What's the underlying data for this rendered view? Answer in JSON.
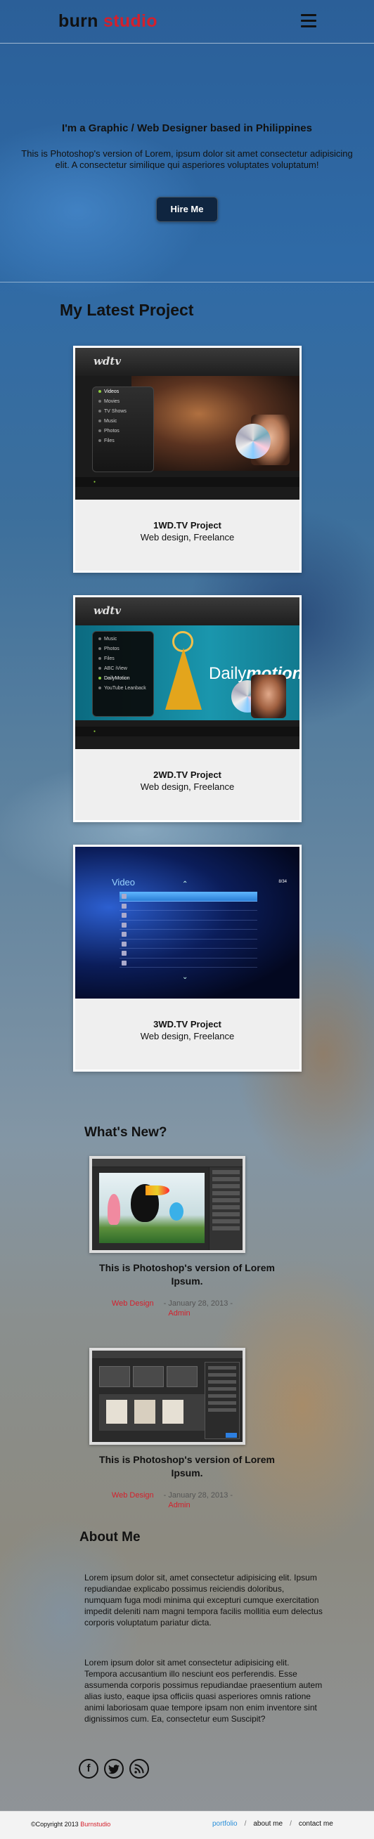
{
  "header": {
    "logo_part1": "burn",
    "logo_part2": "studio"
  },
  "hero": {
    "title": "I'm a Graphic / Web Designer based in Philippines",
    "subtitle": "This is Photoshop's version of Lorem, ipsum dolor sit amet consectetur adipisicing elit. A consectetur similique qui asperiores voluptates voluptatum!",
    "cta_label": "Hire Me"
  },
  "projects": {
    "heading": "My Latest Project",
    "items": [
      {
        "title": "1WD.TV Project",
        "meta": "Web design, Freelance"
      },
      {
        "title": "2WD.TV Project",
        "meta": "Web design, Freelance"
      },
      {
        "title": "3WD.TV Project",
        "meta": "Web design, Freelance"
      }
    ]
  },
  "thumb1": {
    "logo": "wdtv",
    "menu": [
      "Videos",
      "Movies",
      "TV Shows",
      "Music",
      "Photos",
      "Files"
    ]
  },
  "thumb2": {
    "logo": "wdtv",
    "menu": [
      "Music",
      "Photos",
      "Files",
      "ABC iView",
      "DailyMotion",
      "YouTube Leanback"
    ],
    "brand_a": "Daily",
    "brand_b": "motion"
  },
  "thumb3": {
    "title": "Video",
    "count": "8/34"
  },
  "news": {
    "heading": "What's New?",
    "items": [
      {
        "title": "This is Photoshop's version of Lorem Ipsum.",
        "category": "Web Design",
        "date": "- January 28, 2013 -",
        "author": "Admin"
      },
      {
        "title": "This is Photoshop's version of Lorem Ipsum.",
        "category": "Web Design",
        "date": "- January 28, 2013 -",
        "author": "Admin"
      }
    ]
  },
  "about": {
    "heading": "About Me",
    "para1": "Lorem ipsum dolor sit, amet consectetur adipisicing elit. Ipsum repudiandae explicabo possimus reiciendis doloribus, numquam fuga modi minima qui excepturi cumque exercitation impedit deleniti nam magni tempora facilis mollitia eum delectus corporis voluptatum pariatur dicta.",
    "para2": "Lorem ipsum dolor sit amet consectetur adipisicing elit. Tempora accusantium illo nesciunt eos perferendis. Esse assumenda corporis possimus repudiandae praesentium autem alias iusto, eaque ipsa officiis quasi asperiores omnis ratione animi laboriosam quae tempore ipsam non enim inventore sint dignissimos cum. Ea, consectetur eum Suscipit?",
    "social_icons": [
      "facebook-icon",
      "twitter-icon",
      "rss-icon"
    ]
  },
  "footer": {
    "copyright_prefix": "©Copyright 2013",
    "copyright_brand": "Burnstudio",
    "nav": [
      "portfolio",
      "about me",
      "contact me"
    ]
  },
  "colors": {
    "accent_red": "#d4202c",
    "nav_active_blue": "#2a8fd8",
    "button_navy": "#0f2540"
  }
}
